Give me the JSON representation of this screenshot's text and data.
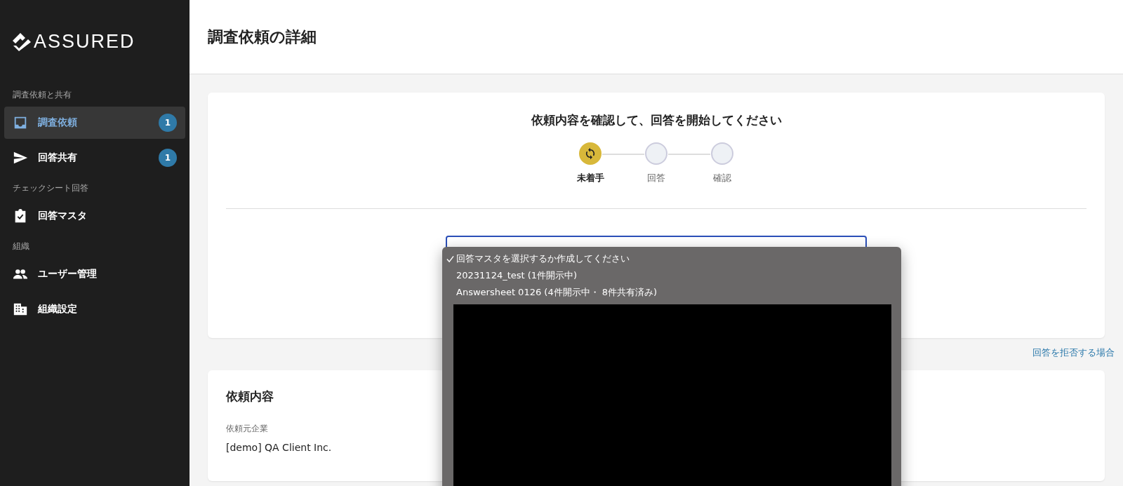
{
  "sidebar": {
    "logo": "ASSURED",
    "sections": [
      {
        "heading": "調査依頼と共有",
        "items": [
          {
            "label": "調査依頼",
            "selected": true,
            "badge": "1"
          },
          {
            "label": "回答共有",
            "selected": false,
            "badge": "1"
          }
        ]
      },
      {
        "heading": "チェックシート回答",
        "items": [
          {
            "label": "回答マスタ",
            "selected": false
          }
        ]
      },
      {
        "heading": "組織",
        "items": [
          {
            "label": "ユーザー管理",
            "selected": false
          },
          {
            "label": "組織設定",
            "selected": false
          }
        ]
      }
    ]
  },
  "page_title": "調査依頼の詳細",
  "status_card": {
    "title": "依頼内容を確認して、回答を開始してください",
    "steps": [
      {
        "label": "未着手",
        "selected": true
      },
      {
        "label": "回答",
        "selected": false
      },
      {
        "label": "確認",
        "selected": false
      }
    ]
  },
  "dropdown": {
    "options": [
      {
        "label": "回答マスタを選択するか作成してください",
        "selected": true
      },
      {
        "label": "20231124_test (1件開示中)",
        "selected": false
      },
      {
        "label": "Answersheet 0126 (4件開示中・ 8件共有済み)",
        "selected": false
      }
    ]
  },
  "decline_link": "回答を拒否する場合",
  "request_card": {
    "title": "依頼内容",
    "fields": [
      {
        "label": "依頼元企業",
        "value": "[demo] QA Client Inc."
      }
    ]
  }
}
